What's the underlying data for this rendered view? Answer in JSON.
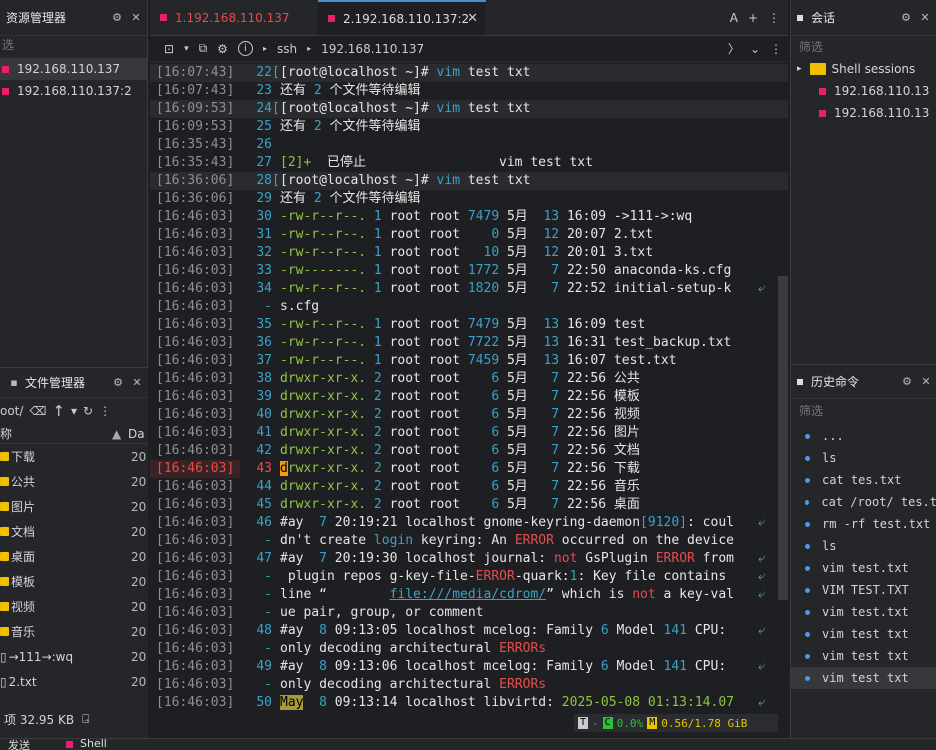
{
  "left": {
    "title": "资源管理器",
    "filter": "选",
    "sessions": [
      "192.168.110.137",
      "192.168.110.137:2"
    ]
  },
  "fm": {
    "title": "文件管理器",
    "path": "oot/",
    "col_name": "称",
    "col_date": "Da",
    "rows": [
      {
        "name": "下载",
        "date": "20"
      },
      {
        "name": "公共",
        "date": "20"
      },
      {
        "name": "图片",
        "date": "20"
      },
      {
        "name": "文档",
        "date": "20"
      },
      {
        "name": "桌面",
        "date": "20"
      },
      {
        "name": "模板",
        "date": "20"
      },
      {
        "name": "视频",
        "date": "20"
      },
      {
        "name": "音乐",
        "date": "20"
      },
      {
        "name": "→111→:wq",
        "date": "20"
      },
      {
        "name": "2.txt",
        "date": "20"
      }
    ],
    "footer": "项 32.95 KB"
  },
  "tabs": [
    {
      "label": "1.192.168.110.137"
    },
    {
      "label": "2.192.168.110.137:2"
    }
  ],
  "toolbar": {
    "proto": "ssh",
    "host": "192.168.110.137"
  },
  "status": {
    "cpu": "0.0%",
    "mem": "0.56/1.78 GiB"
  },
  "right": {
    "sessions_title": "会话",
    "filter": "筛选",
    "folder": "Shell sessions",
    "items": [
      "192.168.110.13",
      "192.168.110.13"
    ],
    "history_title": "历史命令",
    "history_filter": "筛选",
    "history": [
      "...",
      "ls",
      "cat tes.txt",
      "cat /root/ tes.t",
      "rm -rf test.txt",
      "ls",
      "vim test.txt",
      "VIM TEST.TXT",
      "vim test.txt",
      "vim test txt",
      "vim test txt",
      "vim test txt"
    ]
  },
  "bottom": {
    "send": "发送",
    "shell": "Shell"
  },
  "terminal": [
    {
      "ts": "[16:07:43]",
      "n": "22",
      "h": 1,
      "t": "[root@localhost ~]# vim test txt"
    },
    {
      "ts": "[16:07:43]",
      "n": "23",
      "t": "还有 2 个文件等待编辑"
    },
    {
      "ts": "[16:09:53]",
      "n": "24",
      "h": 1,
      "t": "[root@localhost ~]# vim test txt"
    },
    {
      "ts": "[16:09:53]",
      "n": "25",
      "t": "还有 2 个文件等待编辑"
    },
    {
      "ts": "[16:35:43]",
      "n": "26",
      "t": ""
    },
    {
      "ts": "[16:35:43]",
      "n": "27",
      "t": "[2]+  已停止                 vim test txt"
    },
    {
      "ts": "[16:36:06]",
      "n": "28",
      "h": 1,
      "t": "[root@localhost ~]# vim test txt"
    },
    {
      "ts": "[16:36:06]",
      "n": "29",
      "t": "还有 2 个文件等待编辑"
    },
    {
      "ts": "[16:46:03]",
      "n": "30",
      "p": "-rw-r--r--.",
      "t": " 1 root root 7479 5月  13 16:09 ->111->:wq"
    },
    {
      "ts": "[16:46:03]",
      "n": "31",
      "p": "-rw-r--r--.",
      "t": " 1 root root    0 5月  12 20:07 2.txt"
    },
    {
      "ts": "[16:46:03]",
      "n": "32",
      "p": "-rw-r--r--.",
      "t": " 1 root root   10 5月  12 20:01 3.txt"
    },
    {
      "ts": "[16:46:03]",
      "n": "33",
      "p": "-rw-------.",
      "t": " 1 root root 1772 5月   7 22:50 anaconda-ks.cfg"
    },
    {
      "ts": "[16:46:03]",
      "n": "34",
      "p": "-rw-r--r--.",
      "t": " 1 root root 1820 5月   7 22:52 initial-setup-k",
      "w": 1
    },
    {
      "ts": "[16:46:03]",
      "n": "-",
      "t": "s.cfg"
    },
    {
      "ts": "[16:46:03]",
      "n": "35",
      "p": "-rw-r--r--.",
      "t": " 1 root root 7479 5月  13 16:09 test"
    },
    {
      "ts": "[16:46:03]",
      "n": "36",
      "p": "-rw-r--r--.",
      "t": " 1 root root 7722 5月  13 16:31 test_backup.txt"
    },
    {
      "ts": "[16:46:03]",
      "n": "37",
      "p": "-rw-r--r--.",
      "t": " 1 root root 7459 5月  13 16:07 test.txt"
    },
    {
      "ts": "[16:46:03]",
      "n": "38",
      "p": "drwxr-xr-x.",
      "t": " 2 root root    6 5月   7 22:56 公共"
    },
    {
      "ts": "[16:46:03]",
      "n": "39",
      "p": "drwxr-xr-x.",
      "t": " 2 root root    6 5月   7 22:56 模板"
    },
    {
      "ts": "[16:46:03]",
      "n": "40",
      "p": "drwxr-xr-x.",
      "t": " 2 root root    6 5月   7 22:56 视频"
    },
    {
      "ts": "[16:46:03]",
      "n": "41",
      "p": "drwxr-xr-x.",
      "t": " 2 root root    6 5月   7 22:56 图片"
    },
    {
      "ts": "[16:46:03]",
      "n": "42",
      "p": "drwxr-xr-x.",
      "t": " 2 root root    6 5月   7 22:56 文档"
    },
    {
      "ts": "[16:46:03]",
      "n": "43",
      "c": 1,
      "p": "rwxr-xr-x.",
      "t": " 2 root root    6 5月   7 22:56 下载"
    },
    {
      "ts": "[16:46:03]",
      "n": "44",
      "p": "drwxr-xr-x.",
      "t": " 2 root root    6 5月   7 22:56 音乐"
    },
    {
      "ts": "[16:46:03]",
      "n": "45",
      "p": "drwxr-xr-x.",
      "t": " 2 root root    6 5月   7 22:56 桌面"
    },
    {
      "ts": "[16:46:03]",
      "n": "46",
      "t": "#ay  7 20:19:21 localhost gnome-keyring-daemon[9120]: coul",
      "w": 1
    },
    {
      "ts": "[16:46:03]",
      "n": "-",
      "t": "dn't create login keyring: An ERROR occurred on the device"
    },
    {
      "ts": "[16:46:03]",
      "n": "47",
      "t": "#ay  7 20:19:30 localhost journal: not GsPlugin ERROR from",
      "w": 1
    },
    {
      "ts": "[16:46:03]",
      "n": "-",
      "t": " plugin repos g-key-file-ERROR-quark:1: Key file contains",
      "w": 1
    },
    {
      "ts": "[16:46:03]",
      "n": "-",
      "t": "line “        file:///media/cdrom/” which is not a key-val",
      "w": 1
    },
    {
      "ts": "[16:46:03]",
      "n": "-",
      "t": "ue pair, group, or comment"
    },
    {
      "ts": "[16:46:03]",
      "n": "48",
      "t": "#ay  8 09:13:05 localhost mcelog: Family 6 Model 141 CPU: ",
      "w": 1
    },
    {
      "ts": "[16:46:03]",
      "n": "-",
      "t": "only decoding architectural ERRORs"
    },
    {
      "ts": "[16:46:03]",
      "n": "49",
      "t": "#ay  8 09:13:06 localhost mcelog: Family 6 Model 141 CPU: ",
      "w": 1
    },
    {
      "ts": "[16:46:03]",
      "n": "-",
      "t": "only decoding architectural ERRORs"
    },
    {
      "ts": "[16:46:03]",
      "n": "50",
      "t": "May  8 09:13:14 localhost libvirtd: 2025-05-08 01:13:14.07",
      "w": 1
    }
  ]
}
